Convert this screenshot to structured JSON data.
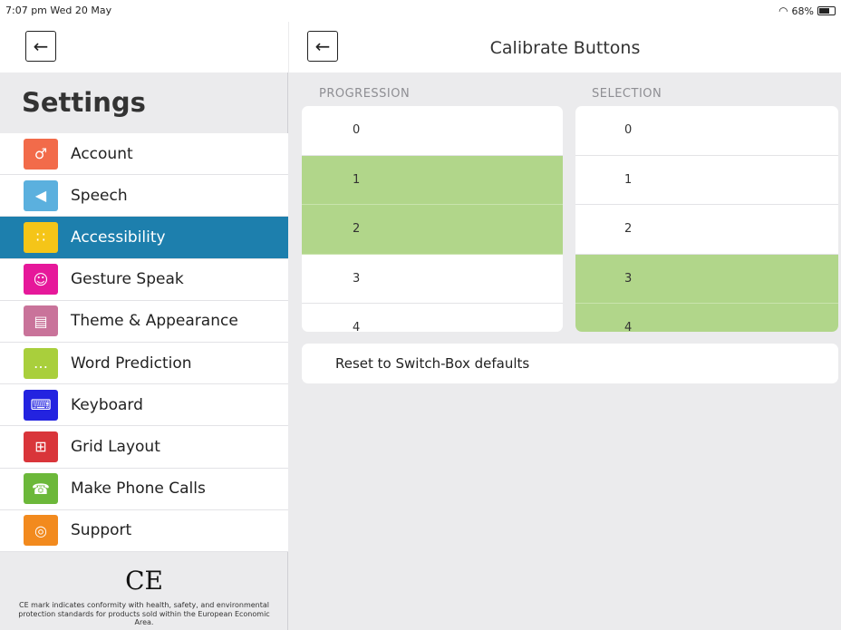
{
  "status": {
    "time": "7:07 pm  Wed 20 May",
    "battery": "68%"
  },
  "sidebar": {
    "title": "Settings",
    "items": [
      {
        "label": "Account",
        "icon": "person-icon",
        "color": "#f26b4a",
        "active": false
      },
      {
        "label": "Speech",
        "icon": "speaker-icon",
        "color": "#5bb0de",
        "active": false
      },
      {
        "label": "Accessibility",
        "icon": "grid-dots-icon",
        "color": "#f5c518",
        "active": true
      },
      {
        "label": "Gesture Speak",
        "icon": "gesture-face-icon",
        "color": "#e6189a",
        "active": false
      },
      {
        "label": "Theme & Appearance",
        "icon": "window-icon",
        "color": "#c9739a",
        "active": false
      },
      {
        "label": "Word Prediction",
        "icon": "prediction-bar-icon",
        "color": "#a9cf3c",
        "active": false
      },
      {
        "label": "Keyboard",
        "icon": "keyboard-icon",
        "color": "#2323e0",
        "active": false
      },
      {
        "label": "Grid Layout",
        "icon": "table-grid-icon",
        "color": "#d9353a",
        "active": false
      },
      {
        "label": "Make Phone Calls",
        "icon": "phone-icon",
        "color": "#6cb83a",
        "active": false
      },
      {
        "label": "Support",
        "icon": "lifebuoy-icon",
        "color": "#f28a1e",
        "active": false
      }
    ],
    "ce_mark": "CE",
    "ce_text": "CE mark indicates conformity with health, safety, and environmental protection standards for products sold within the European Economic Area."
  },
  "main": {
    "title": "Calibrate Buttons",
    "progression": {
      "label": "PROGRESSION",
      "rows": [
        {
          "value": "0",
          "selected": false
        },
        {
          "value": "1",
          "selected": true
        },
        {
          "value": "2",
          "selected": true
        },
        {
          "value": "3",
          "selected": false
        },
        {
          "value": "4",
          "selected": false
        }
      ]
    },
    "selection": {
      "label": "SELECTION",
      "rows": [
        {
          "value": "0",
          "selected": false
        },
        {
          "value": "1",
          "selected": false
        },
        {
          "value": "2",
          "selected": false
        },
        {
          "value": "3",
          "selected": true
        },
        {
          "value": "4",
          "selected": true
        }
      ]
    },
    "reset_label": "Reset to Switch-Box defaults"
  }
}
